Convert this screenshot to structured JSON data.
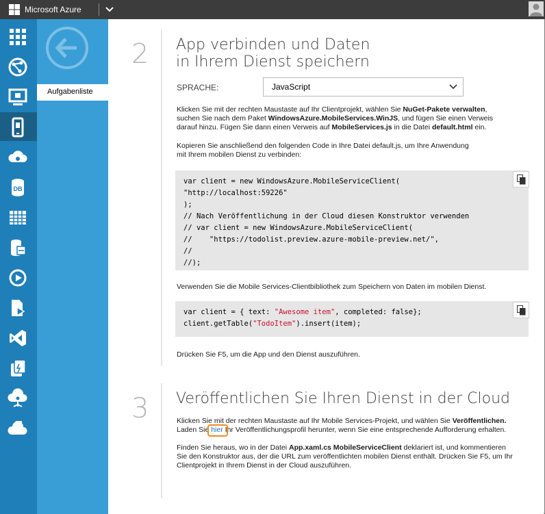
{
  "topbar": {
    "brand": "Microsoft Azure"
  },
  "panel": {
    "item_label": "Aufgabenliste"
  },
  "step2": {
    "number": "2",
    "title_line1": "App verbinden und Daten",
    "title_line2": "in Ihrem Dienst speichern",
    "language_label": "SPRACHE:",
    "language_value": "JavaScript",
    "para1_line1_a": "Klicken Sie mit der rechten Maustaste auf Ihr Clientprojekt, wählen Sie ",
    "para1_line1_b": "NuGet-Pakete verwalten",
    "para1_line1_c": ",",
    "para1_line2_a": "suchen Sie nach dem Paket ",
    "para1_line2_b": "WindowsAzure.MobileServices.WinJS",
    "para1_line2_c": ", und fügen Sie einen Verweis",
    "para1_line3_a": "darauf hinzu. Fügen Sie dann einen Verweis auf ",
    "para1_line3_b": "MobileServices.js",
    "para1_line3_c": " in die Datei ",
    "para1_line3_d": "default.html",
    "para1_line3_e": " ein.",
    "para2_line1": "Kopieren Sie anschließend den folgenden Code in Ihre Datei default.js, um Ihre Anwendung",
    "para2_line2": "mit Ihrem mobilen Dienst zu verbinden:",
    "code1": [
      "var client = new WindowsAzure.MobileServiceClient(",
      "\"http://localhost:59226\"",
      ");",
      "// Nach Veröffentlichung in der Cloud diesen Konstruktor verwenden",
      "// var client = new WindowsAzure.MobileServiceClient(",
      "//    \"https://todolist.preview.azure-mobile-preview.net/\",",
      "//",
      "//);"
    ],
    "para3": "Verwenden Sie die Mobile Services-Clientbibliothek zum Speichern von Daten im mobilen Dienst.",
    "code2": {
      "line1_a": "var client = { text: ",
      "line1_str": "\"Awesome item\"",
      "line1_b": ", completed: false};",
      "line2_a": "client.getTable(",
      "line2_str": "\"TodoItem\"",
      "line2_b": ").insert(item);"
    },
    "para4": "Drücken Sie F5, um die App und den Dienst auszuführen."
  },
  "step3": {
    "number": "3",
    "title": "Veröffentlichen Sie Ihren Dienst in der Cloud",
    "para1_line1_a": "Klicken Sie mit der rechten Maustaste auf Ihr Mobile Services-Projekt, und wählen Sie ",
    "para1_line1_b": "Veröffentlichen.",
    "para1_line2_a": "Laden Sie ",
    "para1_line2_link": "hier",
    "para1_line2_b": " Ihr Veröffentlichungsprofil herunter, wenn Sie eine entsprechende Aufforderung erhalten.",
    "para2_line1_a": "Finden Sie heraus, wo in der Datei ",
    "para2_line1_b": "App.xaml.cs MobileServiceClient",
    "para2_line1_c": " deklariert ist, und kommentieren",
    "para2_line2": "Sie den Konstruktor aus, der die URL zum veröffentlichten mobilen Dienst enthält. Drücken Sie F5, um Ihr",
    "para2_line3": "Clientprojekt in Ihrem Dienst in der Cloud auszuführen."
  },
  "icons": {
    "rail": [
      "grid-icon",
      "globe-icon",
      "virtual-machine-icon",
      "mobile-service-icon",
      "cloud-services-icon",
      "sql-database-icon",
      "storage-table-icon",
      "hdinsight-icon",
      "media-services-icon",
      "import-export-icon",
      "visual-studio-icon",
      "cache-icon",
      "networks-icon",
      "biztalk-icon"
    ]
  },
  "colors": {
    "topbar": "#3c3c3c",
    "rail": "#1f7fb8",
    "panel": "#3a9ed6",
    "code_bg": "#e6e6e6",
    "string": "#c8102e",
    "link": "#1e73b8",
    "highlight": "#f08a1c"
  }
}
